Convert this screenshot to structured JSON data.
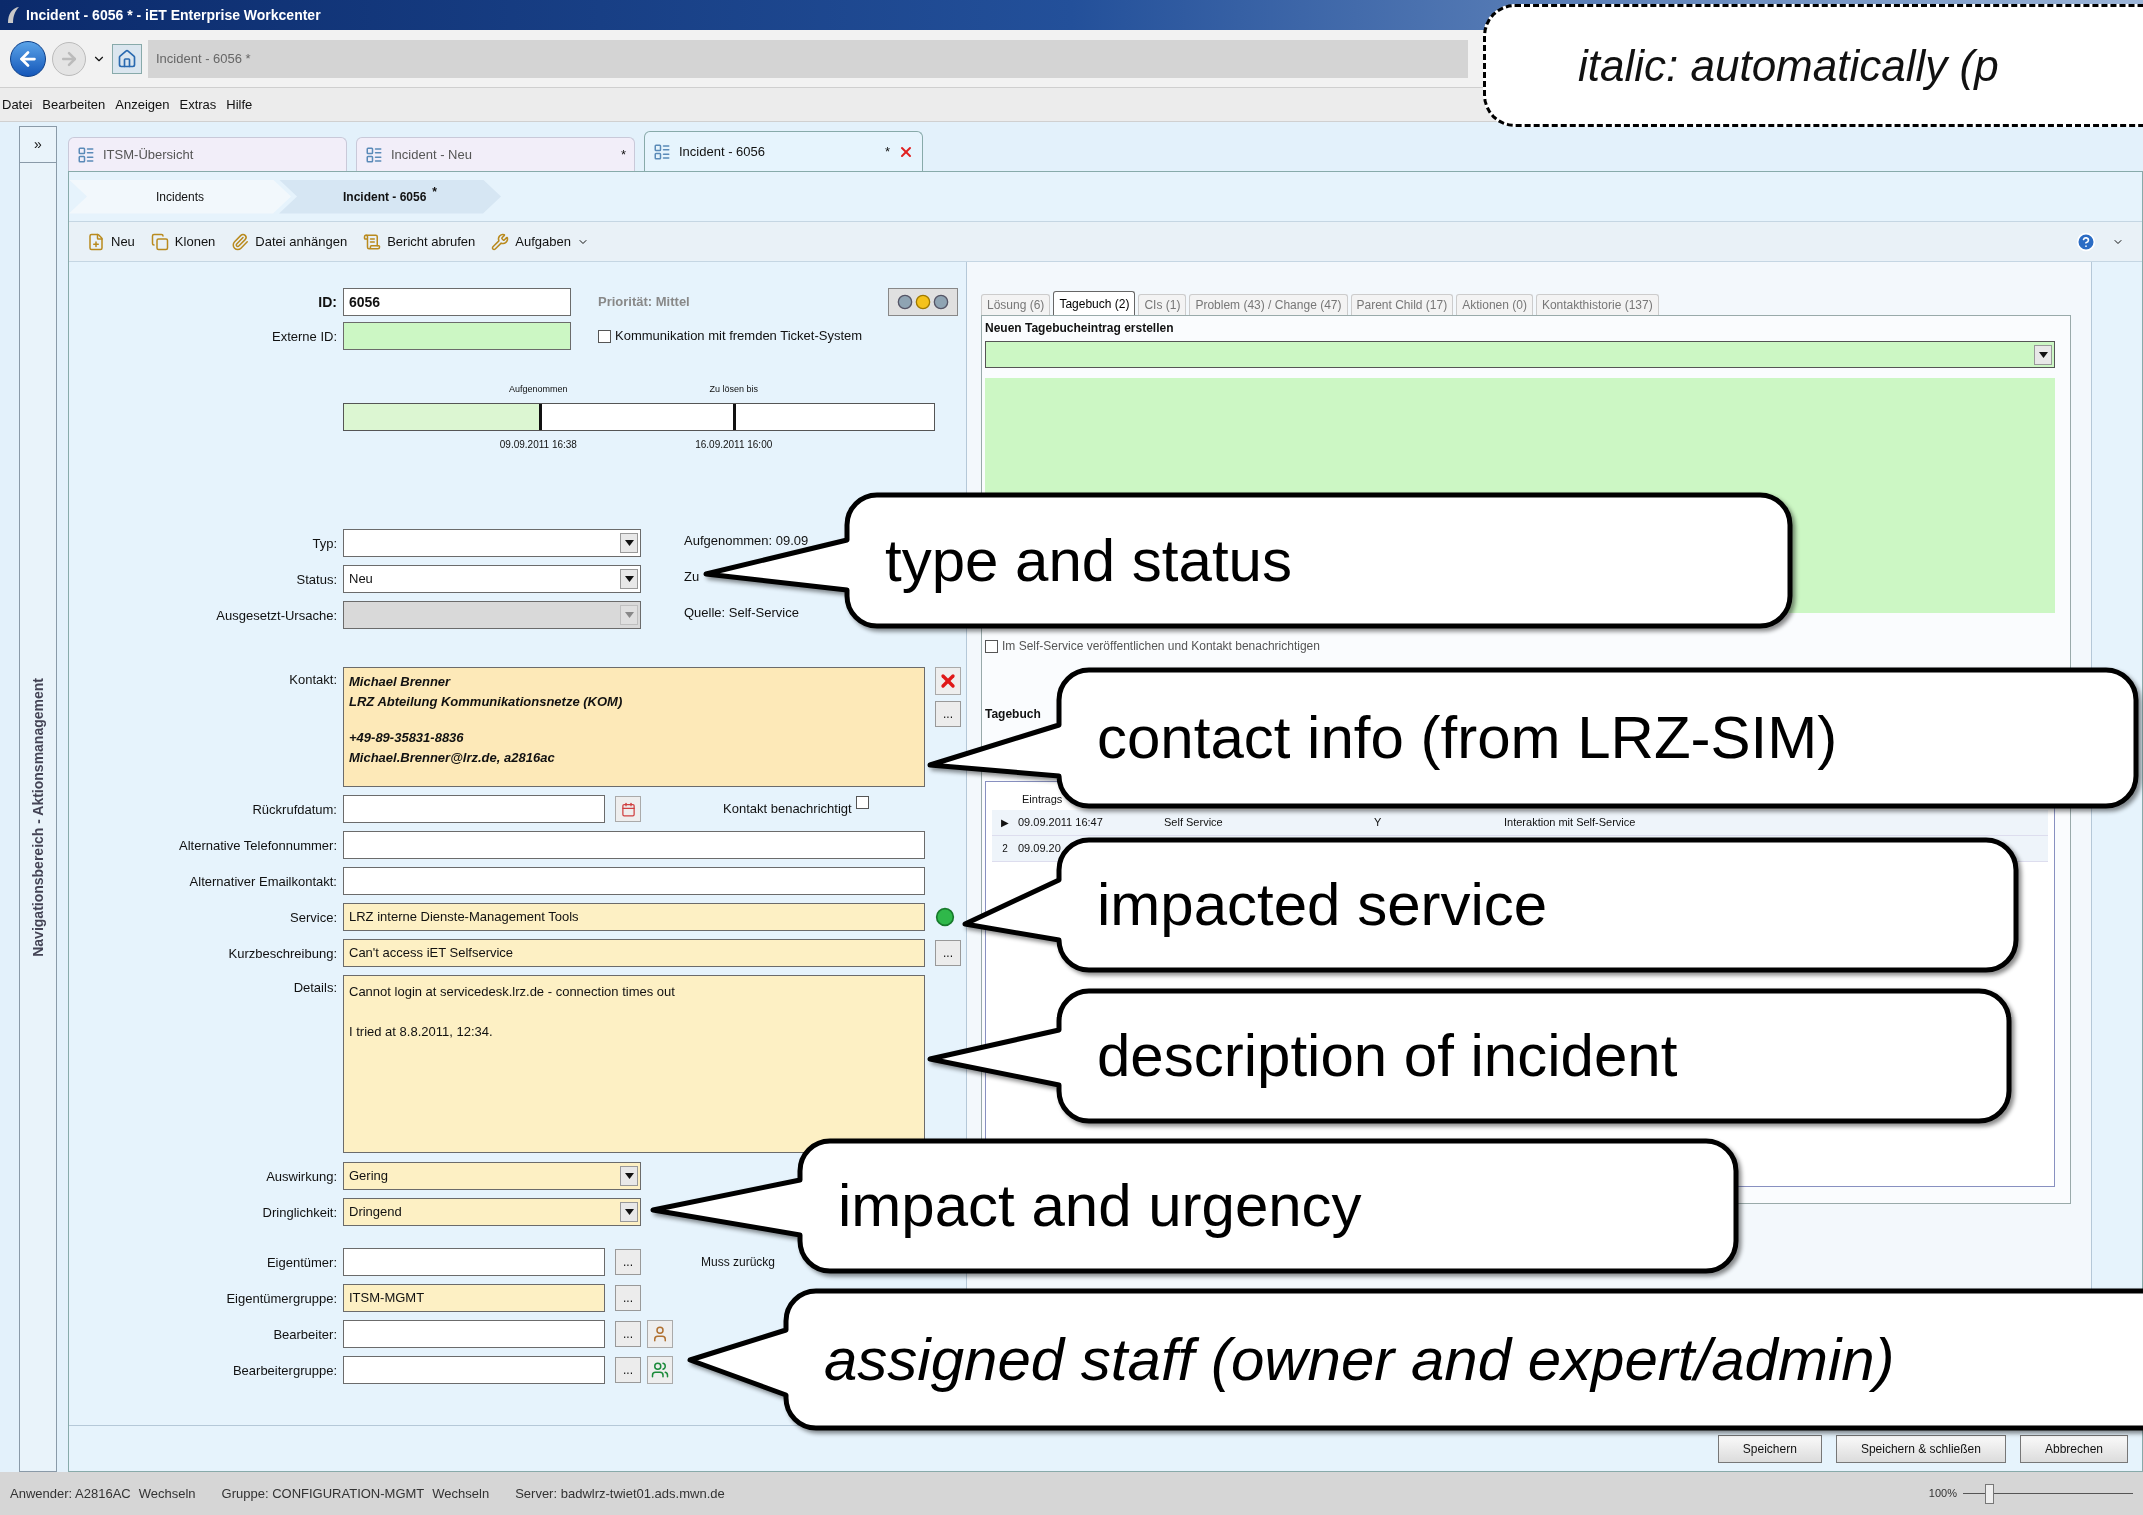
{
  "window": {
    "title": "Incident - 6056 *  -  iET Enterprise Workcenter"
  },
  "address_bar": {
    "value": "Incident - 6056 *"
  },
  "menu": [
    "Datei",
    "Bearbeiten",
    "Anzeigen",
    "Extras",
    "Hilfe"
  ],
  "nav_panel": {
    "toggle": "»",
    "title": "Navigationsbereich - Aktionsmanagement"
  },
  "tabs": [
    {
      "label": "ITSM-Übersicht",
      "selected": false
    },
    {
      "label": "Incident - Neu",
      "marker": "*",
      "selected": false
    },
    {
      "label": "Incident - 6056",
      "marker": "*",
      "selected": true
    }
  ],
  "breadcrumb": [
    {
      "label": "Incidents",
      "selected": false
    },
    {
      "label": "Incident - 6056",
      "marker": "*",
      "selected": true
    }
  ],
  "toolbar": [
    {
      "kind": "new",
      "label": "Neu"
    },
    {
      "kind": "clone",
      "label": "Klonen"
    },
    {
      "kind": "attach",
      "label": "Datei anhängen"
    },
    {
      "kind": "report",
      "label": "Bericht abrufen"
    },
    {
      "kind": "tasks",
      "label": "Aufgaben",
      "menu": true
    }
  ],
  "header": {
    "id": {
      "label": "ID:",
      "value": "6056"
    },
    "priority": "Priorität: Mittel",
    "external_id": {
      "label": "Externe ID:",
      "color": "#ccf7c4"
    },
    "external_checkbox": {
      "label": "Kommunikation mit fremden Ticket-System",
      "checked": false
    }
  },
  "timeline": {
    "level": 0.33,
    "milestones": [
      {
        "label": "Aufgenommen",
        "date": "09.09.2011 16:38",
        "level": 0.33
      },
      {
        "label": "Zu lösen bis",
        "date": "16.09.2011 16:00",
        "level": 0.66
      }
    ]
  },
  "classification": [
    {
      "label": "Typ:",
      "disabled": false,
      "side": "Aufgenommen: 09.09"
    },
    {
      "label": "Status:",
      "value": "Neu",
      "disabled": false,
      "side": "Zu"
    },
    {
      "label": "Ausgesetzt-Ursache:",
      "disabled": true,
      "side": "Quelle: Self-Service"
    }
  ],
  "contact": {
    "label": "Kontakt:",
    "paragraphs": [
      [
        "Michael Brenner",
        "LRZ Abteilung Kommunikationsnetze (KOM)"
      ],
      [
        "+49-89-35831-8836",
        "Michael.Brenner@lrz.de, a2816ac"
      ]
    ],
    "more": "..."
  },
  "callback": {
    "label": "Rückrufdatum:",
    "notify": {
      "label": "Kontakt benachrichtigt",
      "checked": false
    }
  },
  "fields": [
    {
      "kind": "text",
      "label": "Alternative Telefonnummer:",
      "color": "#ffffff"
    },
    {
      "kind": "text",
      "label": "Alternativer Emailkontakt:",
      "color": "#ffffff"
    },
    {
      "kind": "service",
      "label": "Service:",
      "value": "LRZ interne Dienste-Management Tools",
      "color": "#fdf0c4"
    },
    {
      "kind": "lookup",
      "label": "Kurzbeschreibung:",
      "value": "Can't access iET Selfservice",
      "color": "#fdf0c4",
      "button": "..."
    },
    {
      "kind": "textarea",
      "label": "Details:",
      "paragraphs": [
        "Cannot login at servicedesk.lrz.de - connection times out",
        "I tried at 8.8.2011, 12:34."
      ],
      "color": "#fdf0c4"
    }
  ],
  "assessment": [
    {
      "label": "Auswirkung:",
      "value": "Gering",
      "color": "#fdf0c4"
    },
    {
      "label": "Dringlichkeit:",
      "value": "Dringend",
      "color": "#fdf0c4"
    }
  ],
  "assignment": [
    {
      "kind": "plain",
      "label": "Eigentümer:",
      "button": "...",
      "color": "#ffffff",
      "side": "Muss zurückg"
    },
    {
      "kind": "plain",
      "label": "Eigentümergruppe:",
      "value": "ITSM-MGMT",
      "button": "...",
      "color": "#fdf0c4"
    },
    {
      "kind": "person",
      "label": "Bearbeiter:",
      "button": "...",
      "color": "#ffffff"
    },
    {
      "kind": "group",
      "label": "Bearbeitergruppe:",
      "button": "...",
      "color": "#ffffff"
    }
  ],
  "detail_tabs": [
    {
      "label": "Lösung  (6)",
      "selected": false
    },
    {
      "label": "Tagebuch (2)",
      "selected": true
    },
    {
      "label": "CIs (1)",
      "selected": false
    },
    {
      "label": "Problem (43) / Change (47)",
      "selected": false
    },
    {
      "label": "Parent Child (17)",
      "selected": false
    },
    {
      "label": "Aktionen (0)",
      "selected": false
    },
    {
      "label": "Kontakthistorie (137)",
      "selected": false
    }
  ],
  "journal": {
    "heading": "Neuen Tagebucheintrag erstellen",
    "publish": {
      "label": "Im Self-Service veröffentlichen und Kontakt benachrichtigen",
      "checked": false
    },
    "list_heading": "Tagebuch",
    "table": {
      "columns": [
        "Eintrags"
      ],
      "rows": [
        {
          "marker": "▶",
          "cells": [
            "09.09.2011 16:47",
            "Self Service",
            "Y",
            "Interaktion mit Self-Service"
          ]
        },
        {
          "marker": "2",
          "cells": [
            "09.09.20"
          ]
        }
      ]
    }
  },
  "actions": [
    "Speichern",
    "Speichern & schließen",
    "Abbrechen"
  ],
  "status_bar": {
    "items": [
      {
        "label": "Anwender:",
        "value": "A2816AC",
        "link": "Wechseln"
      },
      {
        "label": "Gruppe:",
        "value": "CONFIGURATION-MGMT",
        "link": "Wechseln"
      },
      {
        "label": "Server:",
        "value": "badwlrz-twiet01.ads.mwn.de"
      }
    ],
    "zoom": {
      "reading": "100%",
      "level": 0.15
    }
  },
  "callouts": [
    {
      "kind": "note",
      "text": "italic: automatically (p",
      "italic": true
    },
    {
      "kind": "speech",
      "text": "type and status",
      "italic": false
    },
    {
      "kind": "speech",
      "text": "contact info (from LRZ-SIM)",
      "italic": false
    },
    {
      "kind": "speech",
      "text": "impacted service",
      "italic": false
    },
    {
      "kind": "speech",
      "text": "description of incident",
      "italic": false
    },
    {
      "kind": "speech",
      "text": "impact and urgency",
      "italic": false
    },
    {
      "kind": "speech",
      "text": "assigned staff (owner and expert/admin)",
      "italic": true
    }
  ]
}
